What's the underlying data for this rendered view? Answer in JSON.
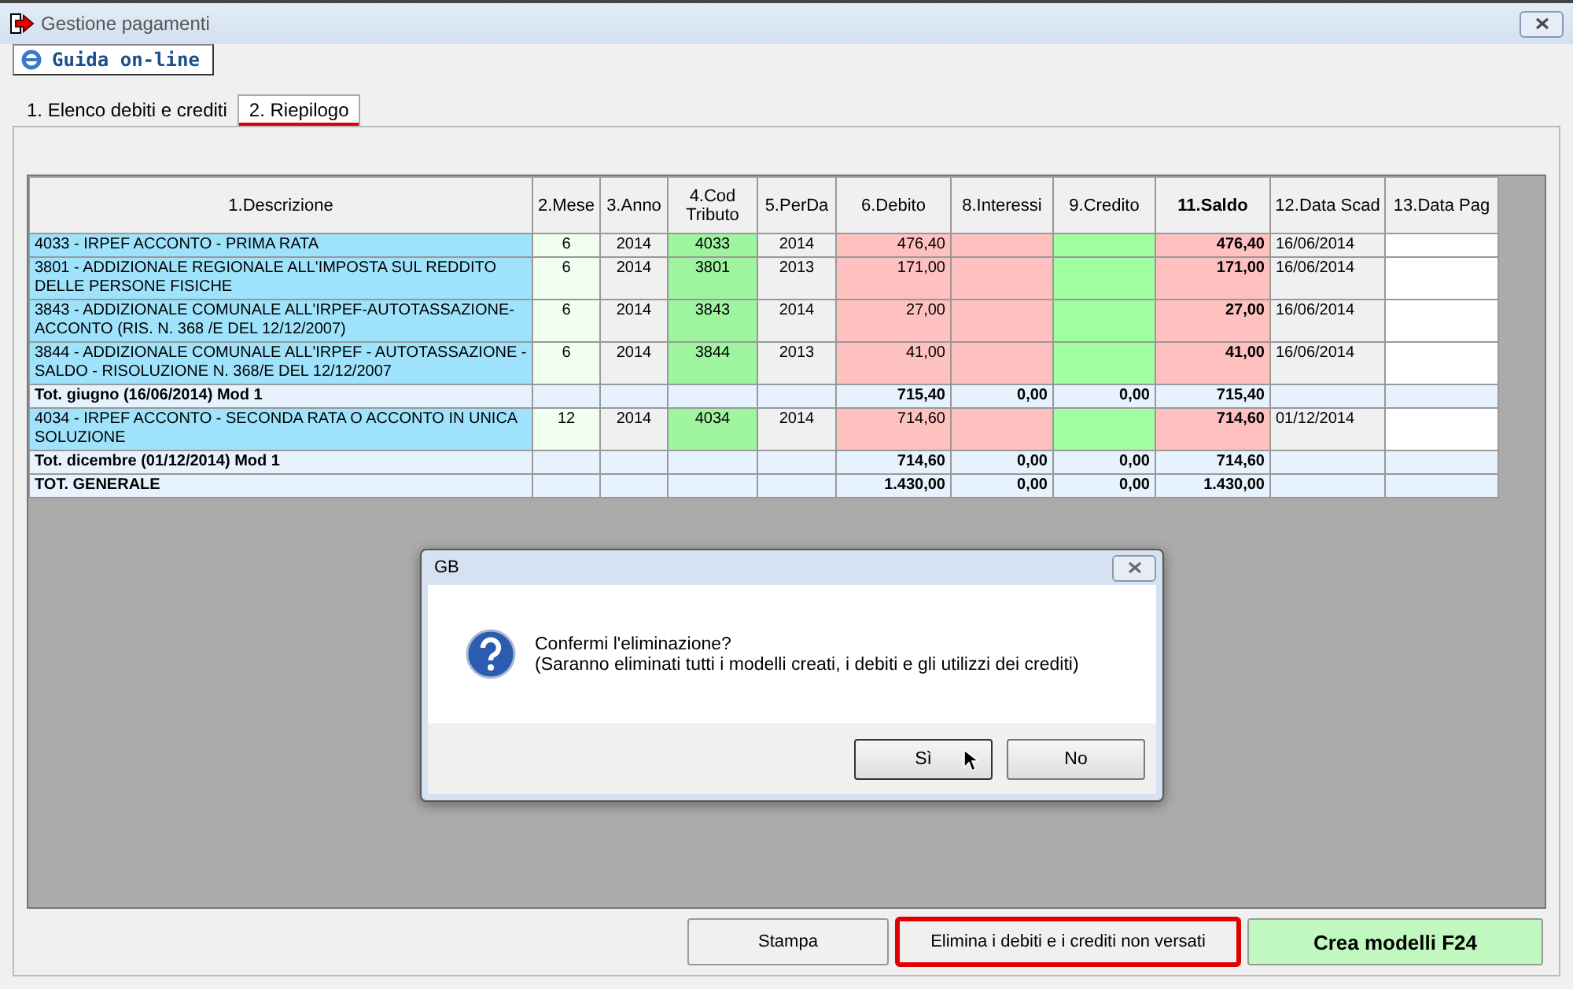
{
  "window": {
    "title": "Gestione pagamenti"
  },
  "help_button": {
    "label": "Guida on-line"
  },
  "tabs": [
    {
      "label": "1. Elenco debiti e crediti",
      "selected": false,
      "highlighted": false
    },
    {
      "label": "2. Riepilogo",
      "selected": true,
      "highlighted": true
    }
  ],
  "table": {
    "columns": [
      {
        "label": "1.Descrizione",
        "bold": false
      },
      {
        "label": "2.Mese",
        "bold": false
      },
      {
        "label": "3.Anno",
        "bold": false
      },
      {
        "label": "4.Cod Tributo",
        "bold": false
      },
      {
        "label": "5.PerDa",
        "bold": false
      },
      {
        "label": "6.Debito",
        "bold": false
      },
      {
        "label": "8.Interessi",
        "bold": false
      },
      {
        "label": "9.Credito",
        "bold": false
      },
      {
        "label": "11.Saldo",
        "bold": true
      },
      {
        "label": "12.Data Scad",
        "bold": false
      },
      {
        "label": "13.Data Pag",
        "bold": false
      }
    ],
    "rows": [
      {
        "kind": "item",
        "description": "4033 - IRPEF ACCONTO - PRIMA RATA",
        "month": "6",
        "year": "2014",
        "code": "4033",
        "period": "2014",
        "debit": "476,40",
        "balance": "476,40",
        "due_date": "16/06/2014"
      },
      {
        "kind": "item",
        "description": "3801 - ADDIZIONALE REGIONALE ALL'IMPOSTA SUL REDDITO DELLE PERSONE FISICHE",
        "month": "6",
        "year": "2014",
        "code": "3801",
        "period": "2013",
        "debit": "171,00",
        "balance": "171,00",
        "due_date": "16/06/2014"
      },
      {
        "kind": "item",
        "description": "3843 - ADDIZIONALE COMUNALE ALL'IRPEF-AUTOTASSAZIONE-ACCONTO (RIS. N. 368 /E DEL 12/12/2007)",
        "month": "6",
        "year": "2014",
        "code": "3843",
        "period": "2014",
        "debit": "27,00",
        "balance": "27,00",
        "due_date": "16/06/2014"
      },
      {
        "kind": "item",
        "description": "3844 - ADDIZIONALE COMUNALE ALL'IRPEF - AUTOTASSAZIONE - SALDO - RISOLUZIONE N. 368/E DEL 12/12/2007",
        "month": "6",
        "year": "2014",
        "code": "3844",
        "period": "2013",
        "debit": "41,00",
        "balance": "41,00",
        "due_date": "16/06/2014"
      },
      {
        "kind": "total",
        "description": "Tot. giugno (16/06/2014) Mod 1",
        "debit": "715,40",
        "interest": "0,00",
        "credit": "0,00",
        "balance": "715,40"
      },
      {
        "kind": "item",
        "description": "4034 - IRPEF ACCONTO - SECONDA RATA O ACCONTO IN UNICA SOLUZIONE",
        "month": "12",
        "year": "2014",
        "code": "4034",
        "period": "2014",
        "debit": "714,60",
        "balance": "714,60",
        "due_date": "01/12/2014"
      },
      {
        "kind": "total",
        "description": "Tot. dicembre (01/12/2014) Mod 1",
        "debit": "714,60",
        "interest": "0,00",
        "credit": "0,00",
        "balance": "714,60"
      },
      {
        "kind": "total",
        "description": "TOT. GENERALE",
        "debit": "1.430,00",
        "interest": "0,00",
        "credit": "0,00",
        "balance": "1.430,00"
      }
    ]
  },
  "dialog": {
    "title": "GB",
    "message": "Confermi l'eliminazione?",
    "detail": "(Saranno eliminati tutti i modelli creati, i debiti e gli utilizzi dei crediti)",
    "buttons": [
      {
        "label": "Sì",
        "kind": "default"
      },
      {
        "label": "No",
        "kind": "normal"
      }
    ]
  },
  "buttons": [
    {
      "label": "Stampa",
      "kind": "normal",
      "highlighted": false
    },
    {
      "label": "Elimina i debiti e i crediti non versati",
      "kind": "normal",
      "highlighted": true
    },
    {
      "label": "Crea modelli F24",
      "kind": "primary",
      "highlighted": false
    }
  ]
}
